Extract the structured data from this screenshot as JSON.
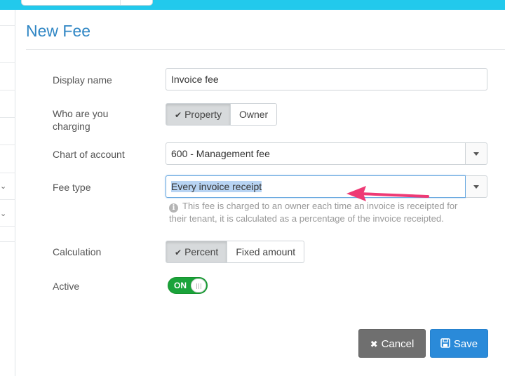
{
  "header": {
    "title": "New Fee"
  },
  "form": {
    "display_name": {
      "label": "Display name",
      "value": "Invoice fee"
    },
    "charging": {
      "label_line1": "Who are you",
      "label_line2": "charging",
      "options": [
        "Property",
        "Owner"
      ],
      "selected": "Property"
    },
    "chart_of_account": {
      "label": "Chart of account",
      "value": "600 - Management fee"
    },
    "fee_type": {
      "label": "Fee type",
      "value": "Every invoice receipt",
      "help": "This fee is charged to an owner each time an invoice is receipted for their tenant, it is calculated as a percentage of the invoice receipted."
    },
    "calculation": {
      "label": "Calculation",
      "options": [
        "Percent",
        "Fixed amount"
      ],
      "selected": "Percent"
    },
    "active": {
      "label": "Active",
      "state": "ON"
    }
  },
  "actions": {
    "cancel": "Cancel",
    "save": "Save"
  },
  "icons": {
    "check": "check-icon",
    "info": "info-icon",
    "cancel": "times-icon",
    "save": "floppy-disk-icon",
    "caret": "caret-down-icon",
    "annotation": "arrow-annotation-icon"
  },
  "colors": {
    "accent": "#22c9ec",
    "title": "#2f86c4",
    "toggle_on": "#1aa33a",
    "save": "#2a8ad9",
    "cancel": "#6f6f6f",
    "annotation": "#ee3a75"
  }
}
